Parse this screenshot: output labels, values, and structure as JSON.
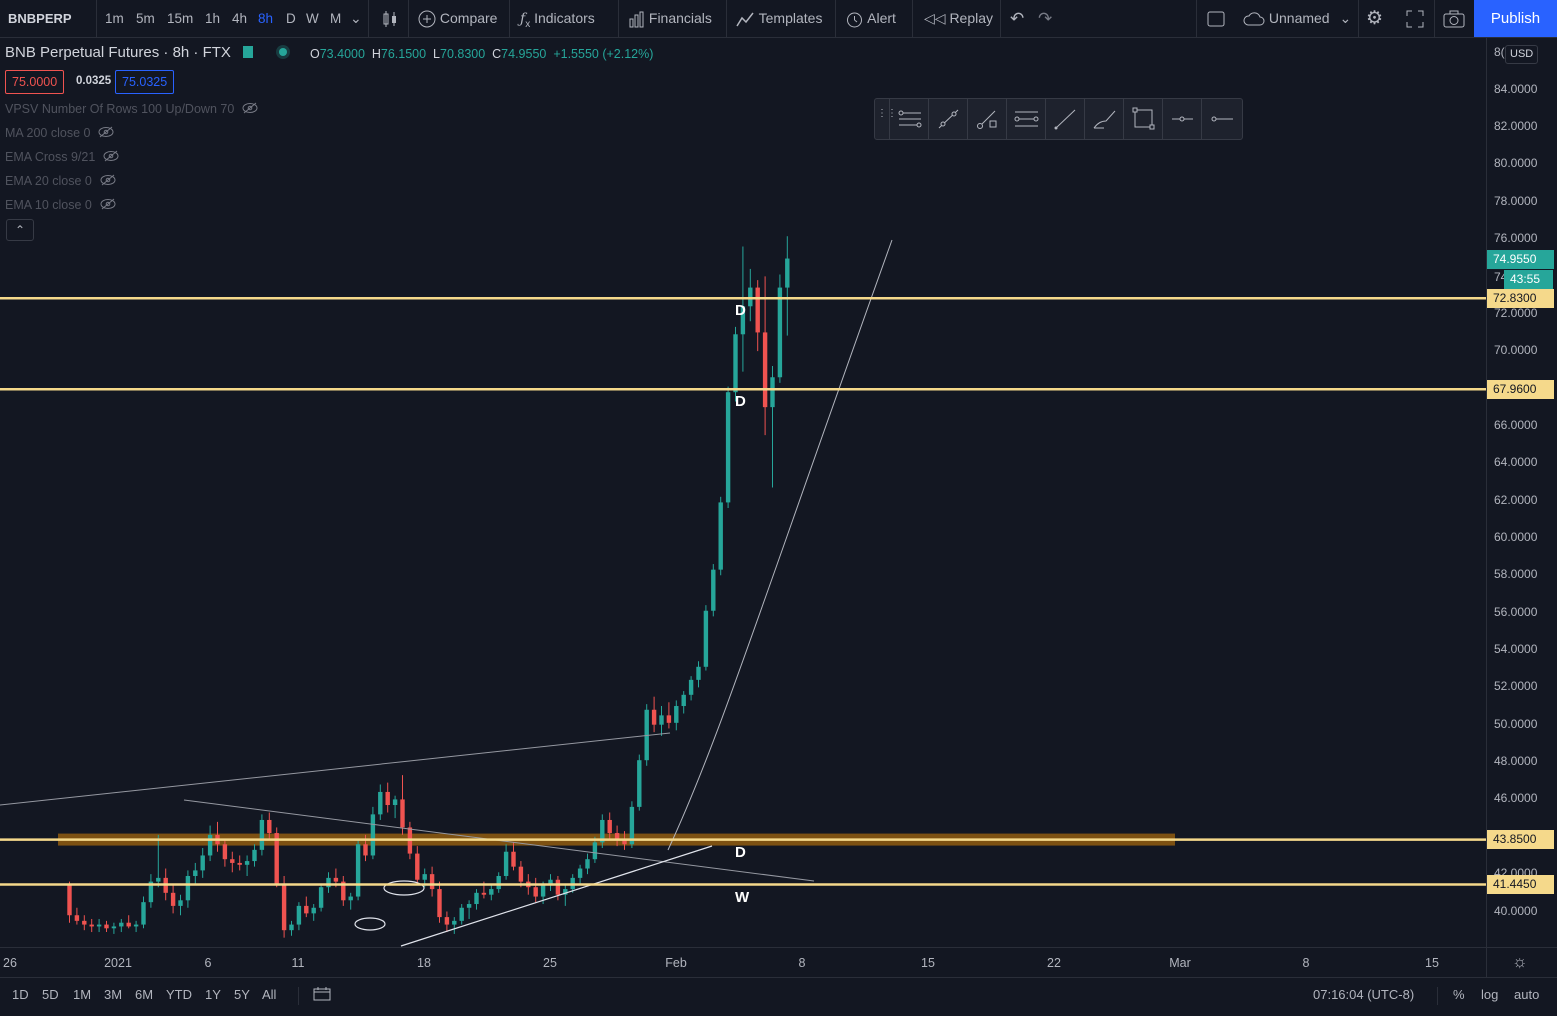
{
  "toolbar": {
    "symbol": "BNBPERP",
    "timeframes": [
      "1m",
      "5m",
      "15m",
      "1h",
      "4h",
      "8h",
      "D",
      "W",
      "M"
    ],
    "active_timeframe": "8h",
    "compare": "Compare",
    "indicators": "Indicators",
    "financials": "Financials",
    "templates": "Templates",
    "alert": "Alert",
    "replay": "Replay",
    "layout_name": "Unnamed",
    "publish": "Publish"
  },
  "legend": {
    "title": "BNB Perpetual Futures · 8h · FTX",
    "o_label": "O",
    "o": "73.4000",
    "h_label": "H",
    "h": "76.1500",
    "l_label": "L",
    "l": "70.8300",
    "c_label": "C",
    "c": "74.9550",
    "change": "+1.5550 (+2.12%)",
    "bid": "75.0000",
    "spread": "0.0325",
    "ask": "75.0325"
  },
  "indicators": [
    "VPSV Number Of Rows 100 Up/Down 70",
    "MA 200 close 0",
    "EMA Cross 9/21",
    "EMA 20 close 0",
    "EMA 10 close 0"
  ],
  "price_axis": {
    "currency": "USD",
    "partial_top": "8(",
    "labels": [
      "84.0000",
      "82.0000",
      "80.0000",
      "78.0000",
      "76.0000",
      "72.0000",
      "70.0000",
      "66.0000",
      "64.0000",
      "62.0000",
      "60.0000",
      "58.0000",
      "56.0000",
      "54.0000",
      "52.0000",
      "50.0000",
      "48.0000",
      "46.0000",
      "42.0000",
      "40.0000"
    ],
    "last_price": "74.9550",
    "countdown": "43:55",
    "partial_last": "74"
  },
  "levels": [
    {
      "price": 72.83,
      "label": "72.8300",
      "zone": "D"
    },
    {
      "price": 67.96,
      "label": "67.9600",
      "zone": "D"
    },
    {
      "price": 43.85,
      "label": "43.8500",
      "zone": "D"
    },
    {
      "price": 41.445,
      "label": "41.4450",
      "zone": "W"
    }
  ],
  "time_axis": [
    "26",
    "2021",
    "6",
    "11",
    "18",
    "25",
    "Feb",
    "8",
    "15",
    "22",
    "Mar",
    "8",
    "15"
  ],
  "bottom": {
    "ranges": [
      "1D",
      "5D",
      "1M",
      "3M",
      "6M",
      "YTD",
      "1Y",
      "5Y",
      "All"
    ],
    "clock": "07:16:04 (UTC-8)",
    "percent": "%",
    "log": "log",
    "auto": "auto"
  },
  "colors": {
    "up": "#26a69a",
    "down": "#ef5350",
    "level": "#f5d98b",
    "zone": "#ff9800",
    "accent": "#2962ff"
  },
  "chart_data": {
    "type": "candlestick",
    "title": "BNB Perpetual Futures · 8h · FTX",
    "ylim": [
      38.8,
      86
    ],
    "x_ticks": [
      "26",
      "2021",
      "6",
      "11",
      "18",
      "25",
      "Feb",
      "8",
      "15",
      "22",
      "Mar",
      "8",
      "15"
    ],
    "candles": [
      [
        41.4,
        41.6,
        39.4,
        39.8
      ],
      [
        39.8,
        40.2,
        39.3,
        39.5
      ],
      [
        39.5,
        39.8,
        39.0,
        39.3
      ],
      [
        39.3,
        39.6,
        38.9,
        39.2
      ],
      [
        39.2,
        39.6,
        38.9,
        39.3
      ],
      [
        39.3,
        39.5,
        38.9,
        39.1
      ],
      [
        39.1,
        39.4,
        38.8,
        39.2
      ],
      [
        39.2,
        39.6,
        38.9,
        39.4
      ],
      [
        39.4,
        39.8,
        39.1,
        39.2
      ],
      [
        39.2,
        39.5,
        38.9,
        39.3
      ],
      [
        39.3,
        40.8,
        39.1,
        40.5
      ],
      [
        40.5,
        42.0,
        40.2,
        41.6
      ],
      [
        41.6,
        44.1,
        41.3,
        41.8
      ],
      [
        41.8,
        42.3,
        40.6,
        41.0
      ],
      [
        41.0,
        41.5,
        39.9,
        40.3
      ],
      [
        40.3,
        40.9,
        39.8,
        40.6
      ],
      [
        40.6,
        42.2,
        40.2,
        41.9
      ],
      [
        41.9,
        42.6,
        41.5,
        42.2
      ],
      [
        42.2,
        43.4,
        41.8,
        43.0
      ],
      [
        43.0,
        44.6,
        42.7,
        44.1
      ],
      [
        44.1,
        44.8,
        43.2,
        43.6
      ],
      [
        43.6,
        43.9,
        42.4,
        42.8
      ],
      [
        42.8,
        43.2,
        42.1,
        42.6
      ],
      [
        42.6,
        43.0,
        42.2,
        42.5
      ],
      [
        42.5,
        43.0,
        41.9,
        42.7
      ],
      [
        42.7,
        43.6,
        42.4,
        43.3
      ],
      [
        43.3,
        45.2,
        43.0,
        44.9
      ],
      [
        44.9,
        45.3,
        43.8,
        44.2
      ],
      [
        44.2,
        44.5,
        41.3,
        41.5
      ],
      [
        41.5,
        41.9,
        38.6,
        39.0
      ],
      [
        39.0,
        39.5,
        38.7,
        39.3
      ],
      [
        39.3,
        40.5,
        39.0,
        40.3
      ],
      [
        40.3,
        40.8,
        39.7,
        39.9
      ],
      [
        39.9,
        40.4,
        39.5,
        40.2
      ],
      [
        40.2,
        41.5,
        40.0,
        41.3
      ],
      [
        41.3,
        42.1,
        41.0,
        41.8
      ],
      [
        41.8,
        42.3,
        41.3,
        41.6
      ],
      [
        41.6,
        41.9,
        40.3,
        40.6
      ],
      [
        40.6,
        41.0,
        40.1,
        40.8
      ],
      [
        40.8,
        43.9,
        40.6,
        43.6
      ],
      [
        43.6,
        44.1,
        42.7,
        43.0
      ],
      [
        43.0,
        45.6,
        42.8,
        45.2
      ],
      [
        45.2,
        46.8,
        44.9,
        46.4
      ],
      [
        46.4,
        46.9,
        45.3,
        45.7
      ],
      [
        45.7,
        46.2,
        45.0,
        46.0
      ],
      [
        46.0,
        47.3,
        44.1,
        44.5
      ],
      [
        44.5,
        44.8,
        42.8,
        43.1
      ],
      [
        43.1,
        43.5,
        41.4,
        41.7
      ],
      [
        41.7,
        42.3,
        41.3,
        42.0
      ],
      [
        42.0,
        42.4,
        40.8,
        41.2
      ],
      [
        41.2,
        41.6,
        39.4,
        39.7
      ],
      [
        39.7,
        40.0,
        38.9,
        39.3
      ],
      [
        39.3,
        39.7,
        38.8,
        39.5
      ],
      [
        39.5,
        40.4,
        39.3,
        40.2
      ],
      [
        40.2,
        40.6,
        39.6,
        40.4
      ],
      [
        40.4,
        41.2,
        40.1,
        41.0
      ],
      [
        41.0,
        41.6,
        40.7,
        40.9
      ],
      [
        40.9,
        41.4,
        40.6,
        41.2
      ],
      [
        41.2,
        42.1,
        41.0,
        41.9
      ],
      [
        41.9,
        43.6,
        41.7,
        43.2
      ],
      [
        43.2,
        43.7,
        42.2,
        42.4
      ],
      [
        42.4,
        42.7,
        41.3,
        41.6
      ],
      [
        41.6,
        42.0,
        40.9,
        41.3
      ],
      [
        41.3,
        41.8,
        40.5,
        40.8
      ],
      [
        40.8,
        41.6,
        40.4,
        41.4
      ],
      [
        41.4,
        42.0,
        41.1,
        41.7
      ],
      [
        41.7,
        41.9,
        40.6,
        40.9
      ],
      [
        40.9,
        41.5,
        40.3,
        41.2
      ],
      [
        41.2,
        42.0,
        41.0,
        41.8
      ],
      [
        41.8,
        42.5,
        41.5,
        42.3
      ],
      [
        42.3,
        43.1,
        42.0,
        42.8
      ],
      [
        42.8,
        44.0,
        42.6,
        43.7
      ],
      [
        43.7,
        45.2,
        43.4,
        44.9
      ],
      [
        44.9,
        45.3,
        43.8,
        44.2
      ],
      [
        44.2,
        44.6,
        43.5,
        43.9
      ],
      [
        43.9,
        44.3,
        43.3,
        43.6
      ],
      [
        43.6,
        45.9,
        43.4,
        45.6
      ],
      [
        45.6,
        48.4,
        45.4,
        48.1
      ],
      [
        48.1,
        51.1,
        47.8,
        50.8
      ],
      [
        50.8,
        51.5,
        49.6,
        50.0
      ],
      [
        50.0,
        51.0,
        49.4,
        50.5
      ],
      [
        50.5,
        51.2,
        49.8,
        50.1
      ],
      [
        50.1,
        51.3,
        49.7,
        51.0
      ],
      [
        51.0,
        51.8,
        50.6,
        51.6
      ],
      [
        51.6,
        52.6,
        51.3,
        52.4
      ],
      [
        52.4,
        53.4,
        52.0,
        53.1
      ],
      [
        53.1,
        56.4,
        52.9,
        56.1
      ],
      [
        56.1,
        58.6,
        55.8,
        58.3
      ],
      [
        58.3,
        62.2,
        58.0,
        61.9
      ],
      [
        61.9,
        68.1,
        61.6,
        67.8
      ],
      [
        67.8,
        71.3,
        67.3,
        70.9
      ],
      [
        70.9,
        75.6,
        68.9,
        72.4
      ],
      [
        72.4,
        74.4,
        71.6,
        73.4
      ],
      [
        73.4,
        73.8,
        70.0,
        71.0
      ],
      [
        71.0,
        74.0,
        65.5,
        67.0
      ],
      [
        67.0,
        69.2,
        62.7,
        68.6
      ],
      [
        68.6,
        74.1,
        68.3,
        73.4
      ],
      [
        73.4,
        76.15,
        70.83,
        74.955
      ]
    ],
    "levels": [
      72.83,
      67.96,
      43.85,
      41.445
    ],
    "zone_labels": [
      "D",
      "D",
      "D",
      "W"
    ]
  }
}
